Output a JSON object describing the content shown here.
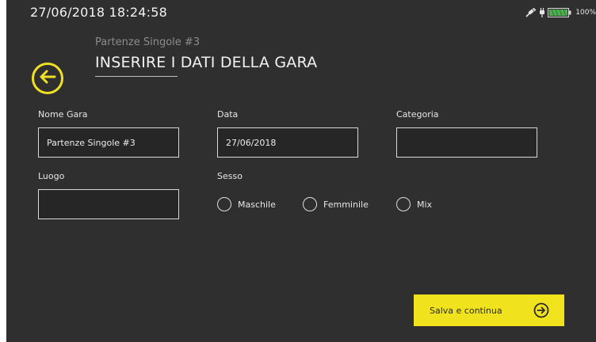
{
  "status": {
    "datetime": "27/06/2018  18:24:58",
    "battery_percent": "100%"
  },
  "header": {
    "subtitle": "Partenze Singole #3",
    "title": "INSERIRE I DATI DELLA GARA"
  },
  "form": {
    "nome_gara": {
      "label": "Nome Gara",
      "value": "Partenze Singole #3"
    },
    "data": {
      "label": "Data",
      "value": "27/06/2018"
    },
    "categoria": {
      "label": "Categoria",
      "value": ""
    },
    "luogo": {
      "label": "Luogo",
      "value": ""
    },
    "sesso": {
      "label": "Sesso",
      "options": [
        "Maschile",
        "Femminile",
        "Mix"
      ]
    }
  },
  "actions": {
    "save_label": "Salva e continua"
  },
  "colors": {
    "background": "#2f2f2f",
    "accent": "#f0e31d",
    "text": "#f2f2f2",
    "subtitle": "#8c8c8c"
  },
  "icons": {
    "back": "arrow-left-circle-icon",
    "save": "arrow-right-circle-icon",
    "gps": "gps-satellite-icon",
    "power": "power-plug-icon",
    "battery": "battery-icon"
  }
}
